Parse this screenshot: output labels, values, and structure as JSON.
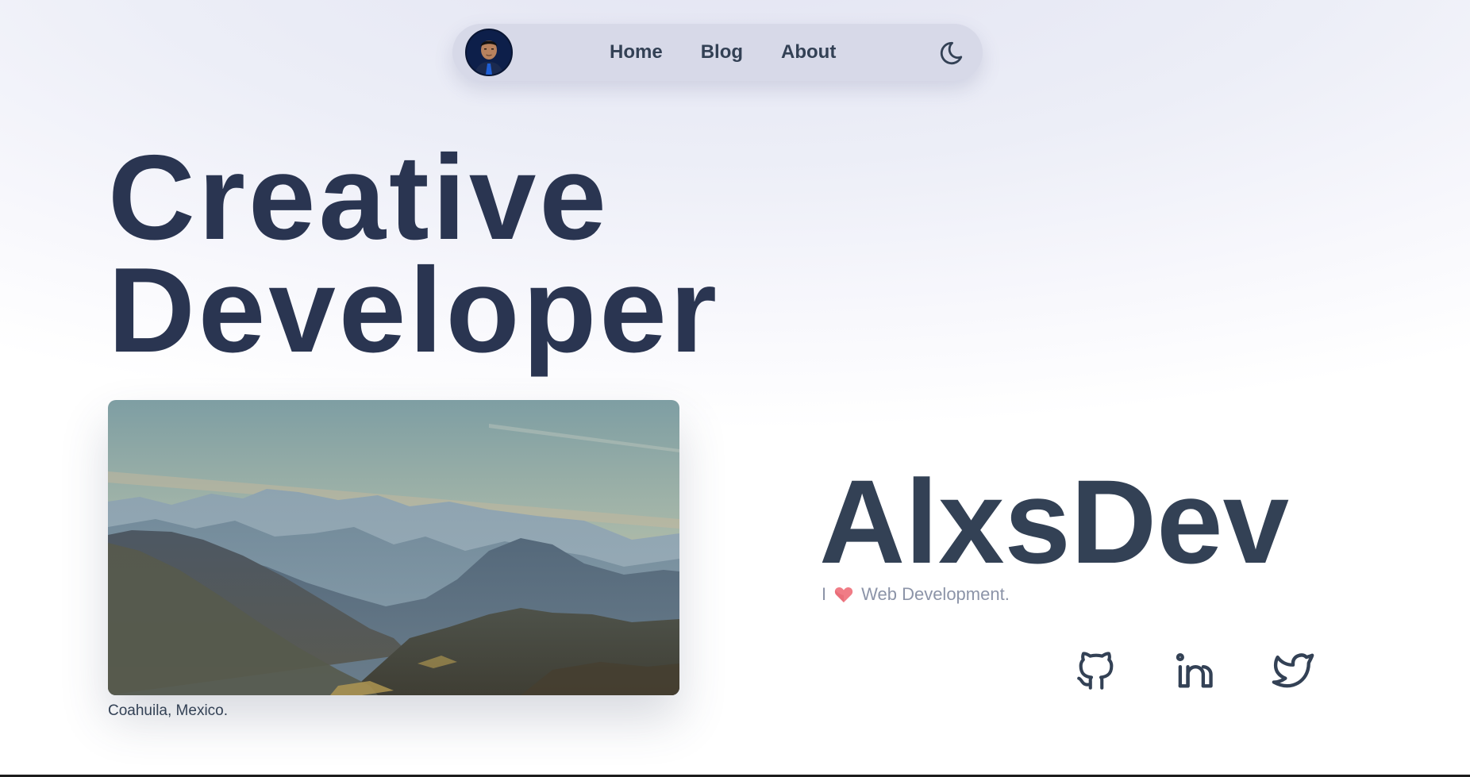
{
  "nav": {
    "links": [
      {
        "label": "Home"
      },
      {
        "label": "Blog"
      },
      {
        "label": "About"
      }
    ],
    "theme_icon": "moon-icon"
  },
  "hero": {
    "title_line1": "Creative",
    "title_line2": "Developer"
  },
  "photo": {
    "caption": "Coahuila, Mexico."
  },
  "brand": {
    "name": "AlxsDev",
    "tagline_prefix": "I",
    "tagline_icon": "heart-icon",
    "tagline_suffix": "Web Development."
  },
  "social": [
    {
      "icon": "github-icon"
    },
    {
      "icon": "linkedin-icon"
    },
    {
      "icon": "twitter-icon"
    }
  ],
  "colors": {
    "heading": "#2a3551",
    "text": "#334155",
    "muted": "#8c94a8",
    "nav_bg": "#d7d9e8",
    "heart": "#f07c86"
  }
}
